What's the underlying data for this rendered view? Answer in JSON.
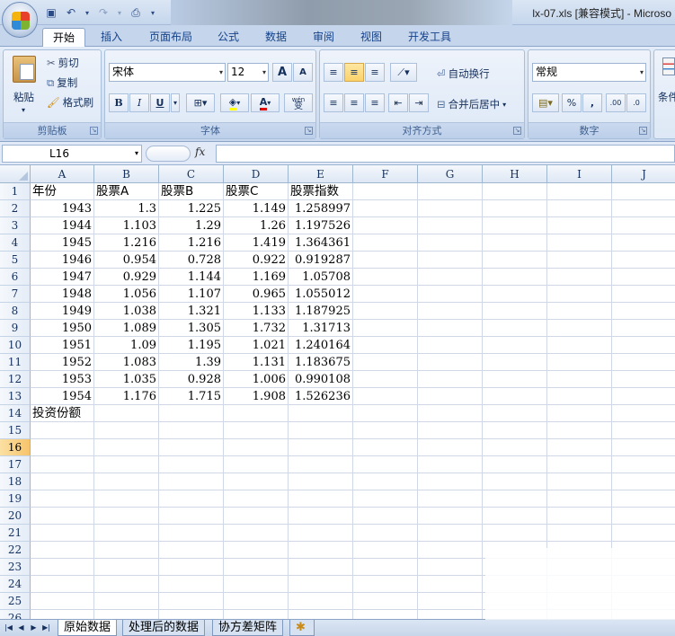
{
  "window": {
    "title": "lx-07.xls [兼容模式] - Microso"
  },
  "ribbon_tabs": [
    "开始",
    "插入",
    "页面布局",
    "公式",
    "数据",
    "审阅",
    "视图",
    "开发工具"
  ],
  "clipboard": {
    "paste": "粘贴",
    "cut": "剪切",
    "copy": "复制",
    "format_painter": "格式刷",
    "group": "剪贴板"
  },
  "font": {
    "name": "宋体",
    "size": "12",
    "group": "字体",
    "grow": "A",
    "shrink": "A",
    "bold": "B",
    "italic": "I",
    "underline": "U",
    "wen": "wén",
    "wen_char": "变"
  },
  "alignment": {
    "wrap": "自动换行",
    "merge": "合并后居中",
    "group": "对齐方式"
  },
  "number": {
    "format": "常规",
    "percent": "%",
    "comma": ",",
    "inc": ".00",
    "dec": ".0",
    "group": "数字"
  },
  "styles": {
    "label": "条件"
  },
  "formula_bar": {
    "cell_ref": "L16",
    "fx": "fx",
    "content": ""
  },
  "columns": [
    "A",
    "B",
    "C",
    "D",
    "E",
    "F",
    "G",
    "H",
    "I",
    "J"
  ],
  "rows": [
    "1",
    "2",
    "3",
    "4",
    "5",
    "6",
    "7",
    "8",
    "9",
    "10",
    "11",
    "12",
    "13",
    "14",
    "15",
    "16",
    "17",
    "18",
    "19",
    "20",
    "21",
    "22",
    "23",
    "24",
    "25",
    "26"
  ],
  "selected_row": "16",
  "header_row": [
    "年份",
    "股票A",
    "股票B",
    "股票C",
    "股票指数"
  ],
  "data_rows": [
    [
      "1943",
      "1.3",
      "1.225",
      "1.149",
      "1.258997"
    ],
    [
      "1944",
      "1.103",
      "1.29",
      "1.26",
      "1.197526"
    ],
    [
      "1945",
      "1.216",
      "1.216",
      "1.419",
      "1.364361"
    ],
    [
      "1946",
      "0.954",
      "0.728",
      "0.922",
      "0.919287"
    ],
    [
      "1947",
      "0.929",
      "1.144",
      "1.169",
      "1.05708"
    ],
    [
      "1948",
      "1.056",
      "1.107",
      "0.965",
      "1.055012"
    ],
    [
      "1949",
      "1.038",
      "1.321",
      "1.133",
      "1.187925"
    ],
    [
      "1950",
      "1.089",
      "1.305",
      "1.732",
      "1.31713"
    ],
    [
      "1951",
      "1.09",
      "1.195",
      "1.021",
      "1.240164"
    ],
    [
      "1952",
      "1.083",
      "1.39",
      "1.131",
      "1.183675"
    ],
    [
      "1953",
      "1.035",
      "0.928",
      "1.006",
      "0.990108"
    ],
    [
      "1954",
      "1.176",
      "1.715",
      "1.908",
      "1.526236"
    ]
  ],
  "row14_label": "投资份额",
  "sheet_tabs": [
    "原始数据",
    "处理后的数据",
    "协方差矩阵"
  ],
  "active_sheet": "原始数据"
}
